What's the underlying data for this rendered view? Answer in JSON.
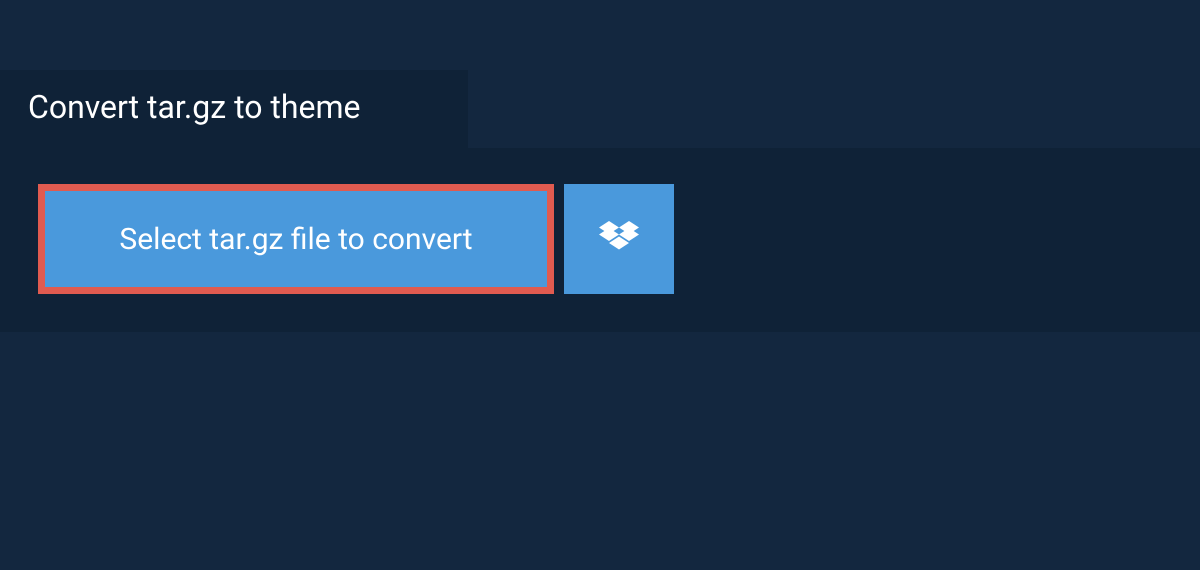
{
  "tab": {
    "title": "Convert tar.gz to theme"
  },
  "buttons": {
    "select_label": "Select tar.gz file to convert"
  },
  "colors": {
    "page_bg": "#13273f",
    "panel_bg": "#0f2237",
    "button_bg": "#4a99dc",
    "button_border": "#e05b50",
    "text": "#ffffff"
  }
}
